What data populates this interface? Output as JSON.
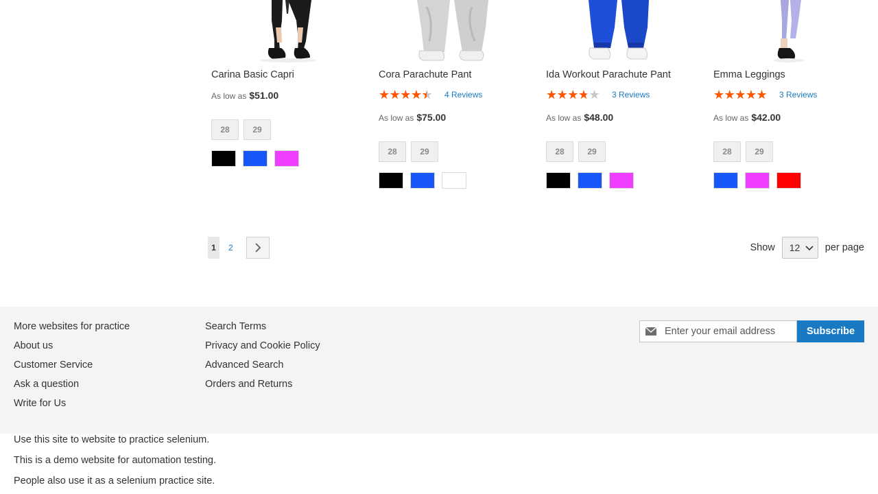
{
  "products": [
    {
      "name": "Carina Basic Capri",
      "rating_percent": null,
      "reviews": "",
      "price_prefix": "As low as",
      "price": "$51.00",
      "sizes": [
        "28",
        "29"
      ],
      "colors": [
        "#000000",
        "#1857f7",
        "#ef3dff"
      ]
    },
    {
      "name": "Cora Parachute Pant",
      "rating_percent": 80,
      "reviews": "4 Reviews",
      "price_prefix": "As low as",
      "price": "$75.00",
      "sizes": [
        "28",
        "29"
      ],
      "colors": [
        "#000000",
        "#1857f7",
        "#ffffff"
      ]
    },
    {
      "name": "Ida Workout Parachute Pant",
      "rating_percent": 67,
      "reviews": "3 Reviews",
      "price_prefix": "As low as",
      "price": "$48.00",
      "sizes": [
        "28",
        "29"
      ],
      "colors": [
        "#000000",
        "#1857f7",
        "#ef3dff"
      ]
    },
    {
      "name": "Emma Leggings",
      "rating_percent": 93,
      "reviews": "3 Reviews",
      "price_prefix": "As low as",
      "price": "$42.00",
      "sizes": [
        "28",
        "29"
      ],
      "colors": [
        "#1857f7",
        "#ef3dff",
        "#ff0000"
      ]
    }
  ],
  "pager": {
    "current": "1",
    "pages": [
      "2"
    ],
    "next_icon": "chevron-right-icon"
  },
  "limiter": {
    "show_label": "Show",
    "value": "12",
    "suffix": "per page"
  },
  "footer": {
    "column1": [
      "More websites for practice",
      "About us",
      "Customer Service",
      "Ask a question",
      "Write for Us"
    ],
    "column2": [
      "Search Terms",
      "Privacy and Cookie Policy",
      "Advanced Search",
      "Orders and Returns"
    ],
    "newsletter": {
      "placeholder": "Enter your email address",
      "button": "Subscribe",
      "icon": "envelope-icon"
    },
    "accent": "#1979c3"
  },
  "notes": [
    "Use this site to website to practice selenium.",
    "This is a demo website for automation testing.",
    "People also use it as a selenium practice site."
  ],
  "colors": {
    "star": "#ff5501",
    "link": "#1979c3"
  }
}
